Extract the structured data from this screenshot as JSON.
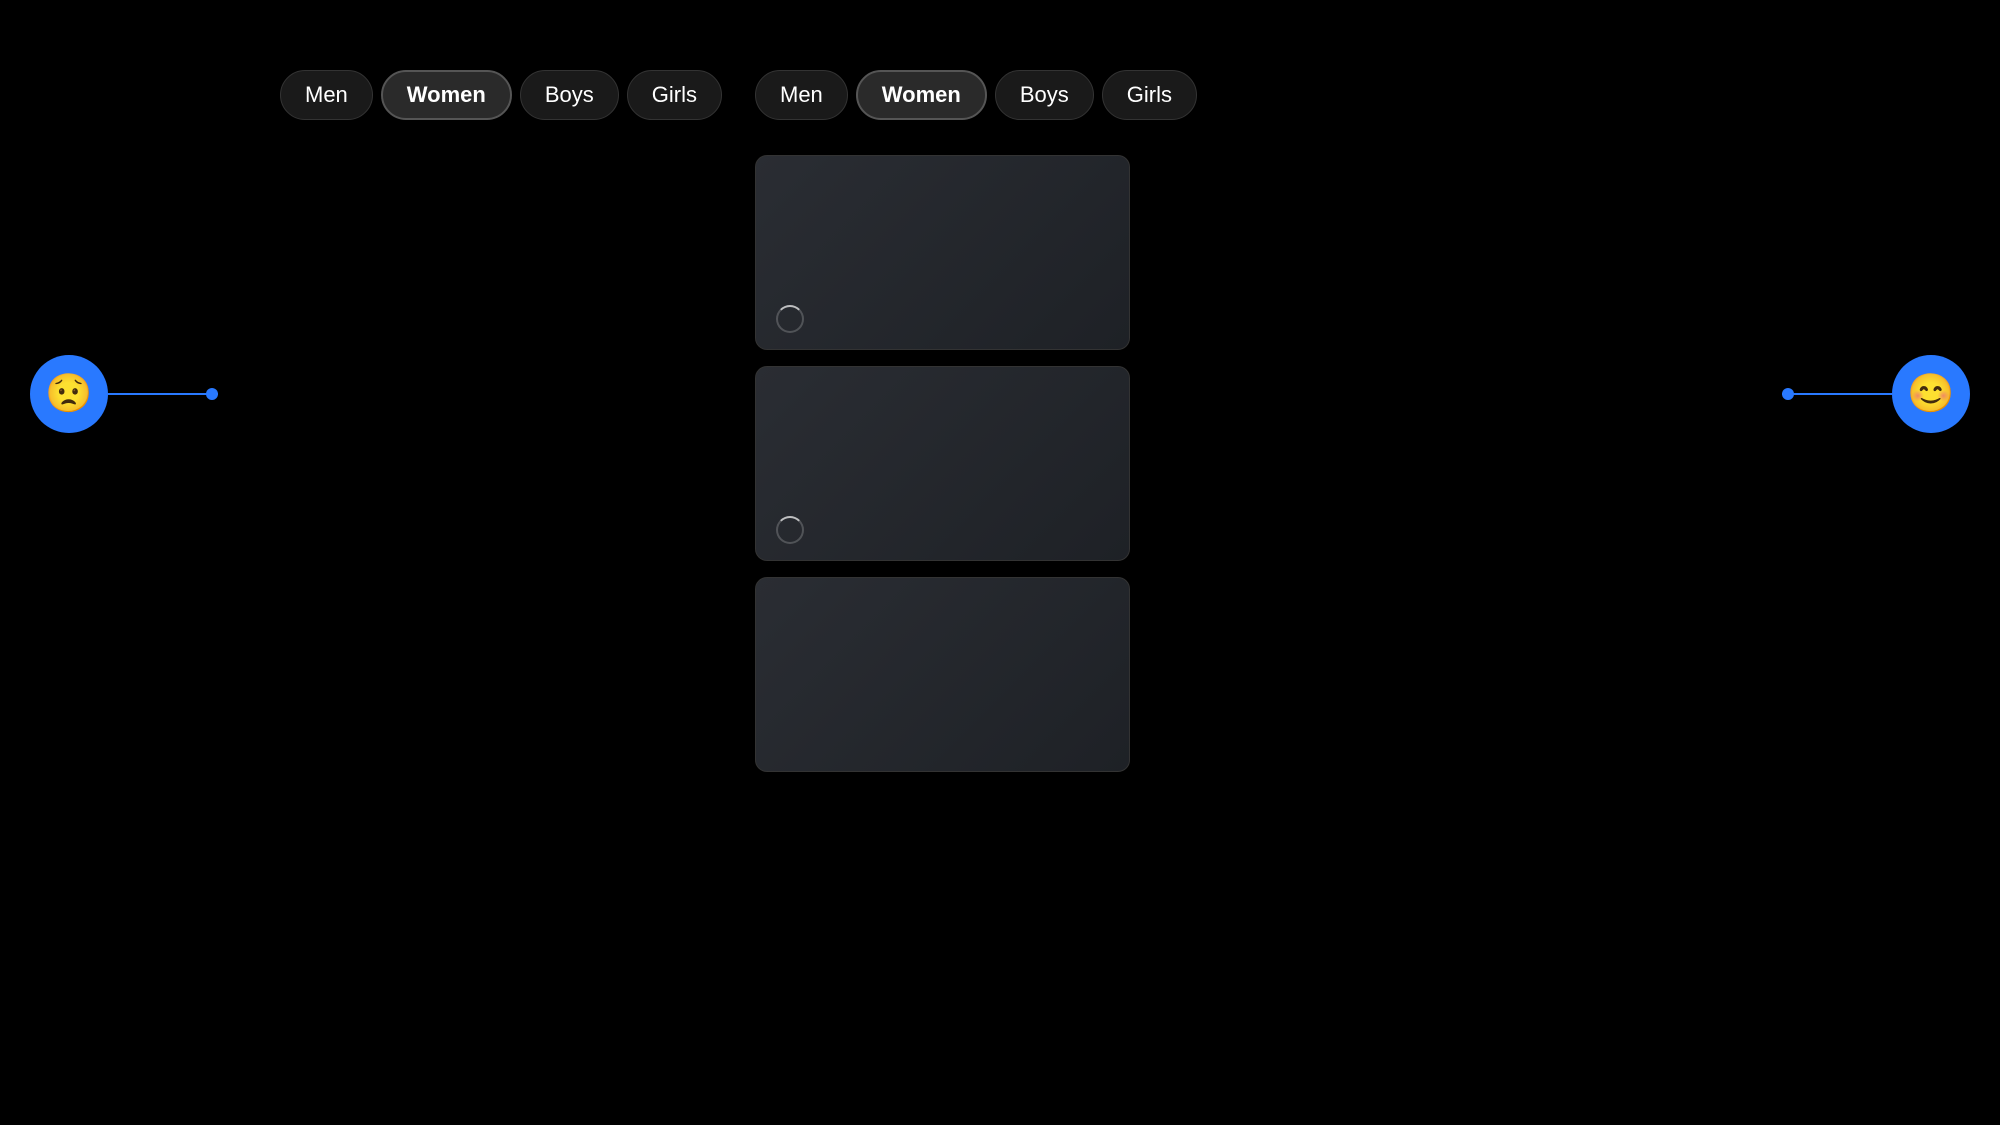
{
  "tabGroupLeft": {
    "tabs": [
      {
        "id": "men-left",
        "label": "Men",
        "active": false
      },
      {
        "id": "women-left",
        "label": "Women",
        "active": true
      },
      {
        "id": "boys-left",
        "label": "Boys",
        "active": false
      },
      {
        "id": "girls-left",
        "label": "Girls",
        "active": false
      }
    ]
  },
  "tabGroupRight": {
    "tabs": [
      {
        "id": "men-right",
        "label": "Men",
        "active": false
      },
      {
        "id": "women-right",
        "label": "Women",
        "active": true
      },
      {
        "id": "boys-right",
        "label": "Boys",
        "active": false
      },
      {
        "id": "girls-right",
        "label": "Girls",
        "active": false
      }
    ]
  },
  "cards": [
    {
      "id": "card-1",
      "hasSpinner": true
    },
    {
      "id": "card-2",
      "hasSpinner": true
    },
    {
      "id": "card-3",
      "hasSpinner": false
    }
  ],
  "navLeft": {
    "emoji": "😟",
    "ariaLabel": "Previous"
  },
  "navRight": {
    "emoji": "😊",
    "ariaLabel": "Next"
  },
  "colors": {
    "accent": "#2979ff",
    "background": "#000000",
    "cardBg": "#2a2d33",
    "tabActive": "#2a2a2a",
    "tabInactive": "#1a1a1a"
  }
}
